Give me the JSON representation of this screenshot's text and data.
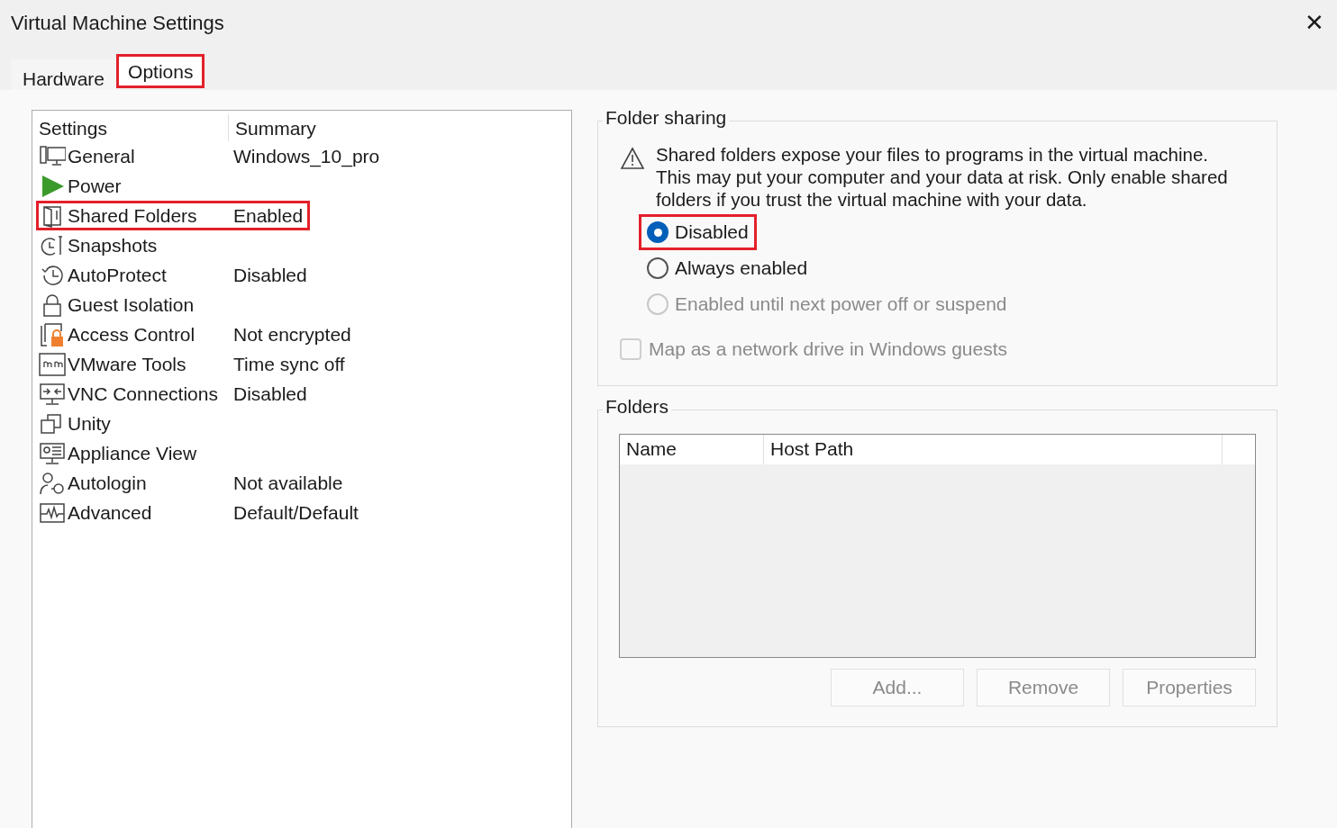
{
  "window": {
    "title": "Virtual Machine Settings",
    "close": "✕"
  },
  "tabs": [
    {
      "label": "Hardware",
      "selected": false,
      "highlighted": false
    },
    {
      "label": "Options",
      "selected": true,
      "highlighted": true
    }
  ],
  "settings_list": {
    "columns": [
      "Settings",
      "Summary"
    ],
    "rows": [
      {
        "name": "General",
        "summary": "Windows_10_pro",
        "highlighted": false
      },
      {
        "name": "Power",
        "summary": "",
        "highlighted": false
      },
      {
        "name": "Shared Folders",
        "summary": "Enabled",
        "highlighted": true
      },
      {
        "name": "Snapshots",
        "summary": "",
        "highlighted": false
      },
      {
        "name": "AutoProtect",
        "summary": "Disabled",
        "highlighted": false
      },
      {
        "name": "Guest Isolation",
        "summary": "",
        "highlighted": false
      },
      {
        "name": "Access Control",
        "summary": "Not encrypted",
        "highlighted": false
      },
      {
        "name": "VMware Tools",
        "summary": "Time sync off",
        "highlighted": false
      },
      {
        "name": "VNC Connections",
        "summary": "Disabled",
        "highlighted": false
      },
      {
        "name": "Unity",
        "summary": "",
        "highlighted": false
      },
      {
        "name": "Appliance View",
        "summary": "",
        "highlighted": false
      },
      {
        "name": "Autologin",
        "summary": "Not available",
        "highlighted": false
      },
      {
        "name": "Advanced",
        "summary": "Default/Default",
        "highlighted": false
      }
    ]
  },
  "folder_sharing": {
    "title": "Folder sharing",
    "warning": "Shared folders expose your files to programs in the virtual machine. This may put your computer and your data at risk. Only enable shared folders if you trust the virtual machine with your data.",
    "options": [
      {
        "label": "Disabled",
        "selected": true,
        "disabled": false,
        "highlighted": true
      },
      {
        "label": "Always enabled",
        "selected": false,
        "disabled": false,
        "highlighted": false
      },
      {
        "label": "Enabled until next power off or suspend",
        "selected": false,
        "disabled": true,
        "highlighted": false
      }
    ],
    "map_drive": {
      "label": "Map as a network drive in Windows guests",
      "checked": false,
      "disabled": true
    }
  },
  "folders": {
    "title": "Folders",
    "columns": [
      "Name",
      "Host Path"
    ],
    "buttons": [
      {
        "label": "Add...",
        "disabled": true
      },
      {
        "label": "Remove",
        "disabled": true
      },
      {
        "label": "Properties",
        "disabled": true
      }
    ]
  }
}
